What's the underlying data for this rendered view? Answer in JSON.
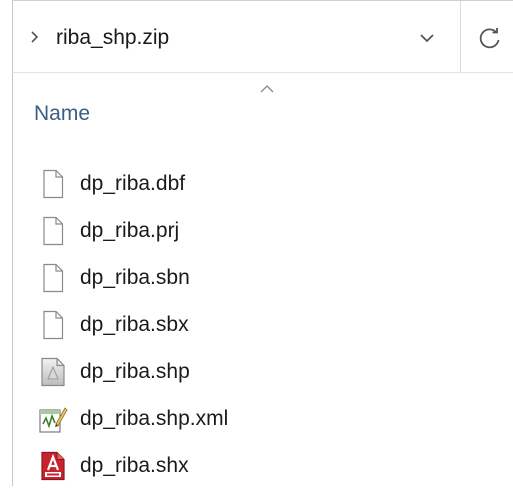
{
  "address": {
    "path": "riba_shp.zip"
  },
  "columns": {
    "name_label": "Name"
  },
  "files": [
    {
      "name": "dp_riba.dbf",
      "icon": "blank-document-icon"
    },
    {
      "name": "dp_riba.prj",
      "icon": "blank-document-icon"
    },
    {
      "name": "dp_riba.sbn",
      "icon": "blank-document-icon"
    },
    {
      "name": "dp_riba.sbx",
      "icon": "blank-document-icon"
    },
    {
      "name": "dp_riba.shp",
      "icon": "shapefile-document-icon"
    },
    {
      "name": "dp_riba.shp.xml",
      "icon": "xml-document-icon"
    },
    {
      "name": "dp_riba.shx",
      "icon": "shx-document-icon"
    }
  ],
  "colors": {
    "header_text": "#3b5d86",
    "shx_icon_red": "#c8232c",
    "xml_icon_green": "#6aa84f"
  }
}
